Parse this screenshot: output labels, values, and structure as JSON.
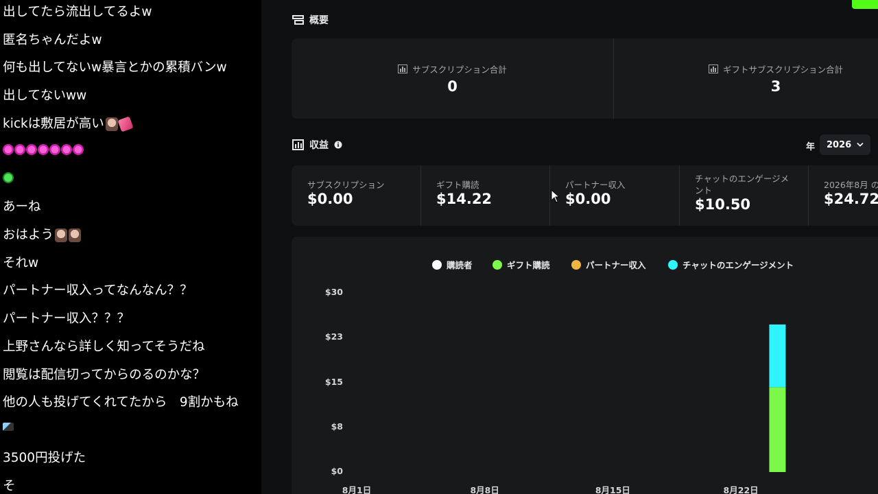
{
  "chat": {
    "messages": [
      {
        "text": "出してたら流出してるよw",
        "emotes": []
      },
      {
        "text": "匿名ちゃんだよw",
        "emotes": []
      },
      {
        "text": "何も出してないw暴言とかの累積バンw",
        "emotes": []
      },
      {
        "text": "出してないww",
        "emotes": []
      },
      {
        "text": "kickは敷居が高い",
        "emotes": [
          "face-emote",
          "arm-emote"
        ]
      },
      {
        "text": "",
        "emotes": [
          "pink-emote",
          "pink-emote",
          "pink-emote",
          "pink-emote",
          "pink-emote",
          "pink-emote",
          "pink-emote"
        ]
      },
      {
        "text": "",
        "emotes": [
          "green-emote"
        ]
      },
      {
        "text": "あーね",
        "emotes": []
      },
      {
        "text": "おはよう",
        "emotes": [
          "face-emote",
          "face-emote"
        ]
      },
      {
        "text": "それw",
        "emotes": []
      },
      {
        "text": "パートナー収入ってなんなん？？",
        "emotes": []
      },
      {
        "text": "パートナー収入？？？",
        "emotes": []
      },
      {
        "text": "上野さんなら詳しく知ってそうだね",
        "emotes": []
      },
      {
        "text": "閲覧は配信切ってからのるのかな？",
        "emotes": []
      },
      {
        "text": "他の人も投げてくれてたから　9割かもね",
        "emotes": []
      },
      {
        "text": "",
        "emotes": [
          "tiny-emote"
        ]
      },
      {
        "text": "3500円投げた",
        "emotes": []
      },
      {
        "text": "そ",
        "emotes": []
      }
    ]
  },
  "overview": {
    "title": "概要",
    "subscriptions_total_label": "サブスクリプション合計",
    "subscriptions_total_value": "0",
    "gift_subscriptions_total_label": "ギフトサブスクリプション合計",
    "gift_subscriptions_total_value": "3"
  },
  "revenue": {
    "title": "収益",
    "year_label": "年",
    "year_value": "2026",
    "cards": [
      {
        "label": "サブスクリプション",
        "value": "$0.00"
      },
      {
        "label": "ギフト購読",
        "value": "$14.22"
      },
      {
        "label": "パートナー収入",
        "value": "$0.00"
      },
      {
        "label": "チャットのエンゲージメ\nント",
        "value": "$10.50"
      },
      {
        "label": "2026年8月 の",
        "value": "$24.72"
      }
    ]
  },
  "colors": {
    "subscribers": "#ffffff",
    "gift": "#7cf84a",
    "partner": "#f0b640",
    "chat": "#2ff4ff",
    "kick_green": "#53fc18"
  },
  "chart_data": {
    "type": "bar",
    "stacked": true,
    "legend_position": "top",
    "categories_axis": [
      "8月1日",
      "8月8日",
      "8月15日",
      "8月22日"
    ],
    "yticks": [
      "$30",
      "$23",
      "$15",
      "$8",
      "$0"
    ],
    "ylim": [
      0,
      30
    ],
    "x_bar_date_index": 24,
    "series": [
      {
        "name": "購読者",
        "color": "#ffffff",
        "values": [
          {
            "day": 24,
            "value": 0
          }
        ]
      },
      {
        "name": "ギフト購読",
        "color": "#7cf84a",
        "values": [
          {
            "day": 24,
            "value": 14.22
          }
        ]
      },
      {
        "name": "パートナー収入",
        "color": "#f0b640",
        "values": [
          {
            "day": 24,
            "value": 0
          }
        ]
      },
      {
        "name": "チャットのエンゲージメント",
        "color": "#2ff4ff",
        "values": [
          {
            "day": 24,
            "value": 10.5
          }
        ]
      }
    ]
  }
}
